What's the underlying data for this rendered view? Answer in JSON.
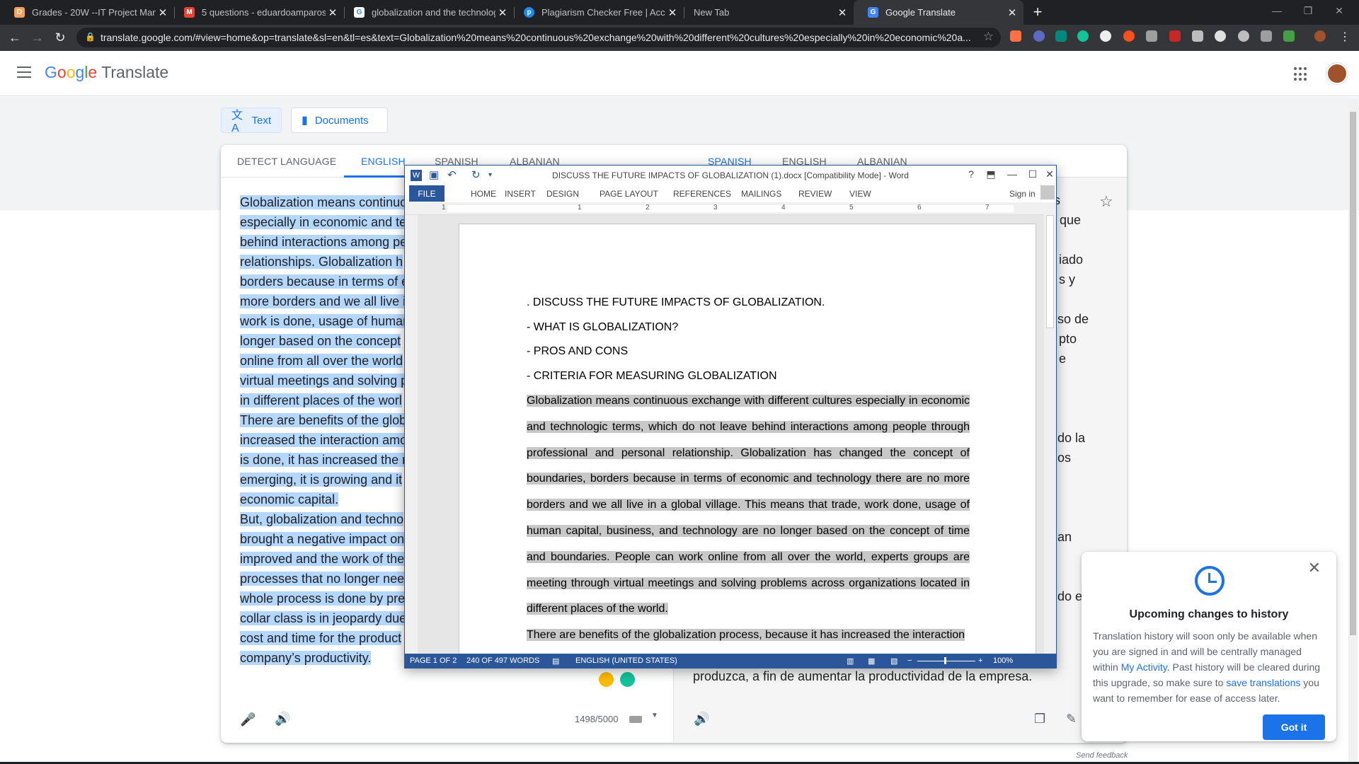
{
  "browser": {
    "tabs": [
      {
        "title": "Grades - 20W --IT Project Manag",
        "icon": "grades-icon",
        "color": "#f4a261"
      },
      {
        "title": "5 questions - eduardoamparos@",
        "icon": "gmail-icon",
        "color": "#ea4335"
      },
      {
        "title": "globalization and the technology",
        "icon": "google-icon",
        "color": "#4285f4"
      },
      {
        "title": "Plagiarism Checker Free | Accura",
        "icon": "plagiarism-icon",
        "color": "#1e88e5"
      },
      {
        "title": "New Tab",
        "icon": "",
        "color": ""
      },
      {
        "title": "Google Translate",
        "icon": "translate-icon",
        "color": "#4285f4"
      }
    ],
    "new_tab": "+",
    "url": "translate.google.com/#view=home&op=translate&sl=en&tl=es&text=Globalization%20means%20continuous%20exchange%20with%20different%20cultures%20especially%20in%20economic%20a..."
  },
  "translate": {
    "logo_google": [
      "G",
      "o",
      "o",
      "g",
      "l",
      "e"
    ],
    "logo_product": "Translate",
    "modes": {
      "text": "Text",
      "documents": "Documents"
    },
    "source_langs": {
      "detect": "DETECT LANGUAGE",
      "l1": "ENGLISH",
      "l2": "SPANISH",
      "l3": "ALBANIAN"
    },
    "target_langs": {
      "l1": "SPANISH",
      "l2": "ENGLISH",
      "l3": "ALBANIAN"
    },
    "source_lines": [
      "Globalization means continuo",
      "especially in economic and te",
      "behind interactions among pe",
      "relationships. Globalization h",
      "borders because in terms of e",
      "more borders and we all live i",
      "work is done, usage of human",
      "longer based on the concept",
      "online from all over the world",
      "virtual meetings and solving p",
      "in different places of the worl",
      "There are benefits of the glob",
      "increased the interaction amo",
      "is done, it has increased the n",
      "emerging, it is growing and it",
      "economic capital.",
      "But, globalization and techno",
      "brought a negative impact on",
      "improved and the work of the",
      "processes that no longer nee",
      "whole process is done by pre",
      "collar class is in jeopardy due",
      "cost and time for the product",
      "company’s productivity."
    ],
    "target_fragments": [
      "s",
      "que",
      "iado",
      "s y",
      "so de",
      "pto",
      "e",
      "do la",
      "os",
      "an",
      "do el"
    ],
    "target_last_line": "produzca, a fin de aumentar la productividad de la empresa.",
    "char_count": "1498/5000",
    "send_feedback": "Send feedback",
    "popup": {
      "title": "Upcoming changes to history",
      "body_1": "Translation history will soon only be available when you are signed in and will be centrally managed within ",
      "link_1": "My Activity",
      "body_2": ". Past history will be cleared during this upgrade, so make sure to ",
      "link_2": "save translations",
      "body_3": " you want to remember for ease of access later.",
      "button": "Got it"
    }
  },
  "word": {
    "title": "DISCUSS THE FUTURE IMPACTS OF GLOBALIZATION (1).docx [Compatibility Mode] - Word",
    "help": "?",
    "tabs": {
      "file": "FILE",
      "home": "HOME",
      "insert": "INSERT",
      "design": "DESIGN",
      "page_layout": "PAGE LAYOUT",
      "references": "REFERENCES",
      "mailings": "MAILINGS",
      "review": "REVIEW",
      "view": "VIEW"
    },
    "sign_in": "Sign in",
    "ruler_numbers": [
      "1",
      "1",
      "2",
      "3",
      "4",
      "5",
      "6",
      "7"
    ],
    "headings": [
      ". DISCUSS THE FUTURE IMPACTS OF GLOBALIZATION.",
      "- WHAT IS GLOBALIZATION?",
      "- PROS AND CONS",
      "- CRITERIA FOR MEASURING GLOBALIZATION"
    ],
    "paragraph_1": "Globalization means continuous exchange with different cultures especially in economic and technologic terms, which do not leave behind interactions among people through professional and personal relationship. Globalization has changed the concept of boundaries, borders because in terms of economic and technology there are no more borders and we all live in a global village. This means that trade, work done, usage of human capital, business, and technology are no longer based on the concept of time and boundaries. People can work online from all over the world, experts groups are meeting through virtual meetings and solving problems across organizations located in different places of the world.",
    "paragraph_2": "There are benefits of the globalization process, because it has increased the interaction",
    "status": {
      "page": "PAGE 1 OF 2",
      "words": "240 OF 497 WORDS",
      "language": "ENGLISH (UNITED STATES)",
      "zoom": "100%"
    }
  }
}
